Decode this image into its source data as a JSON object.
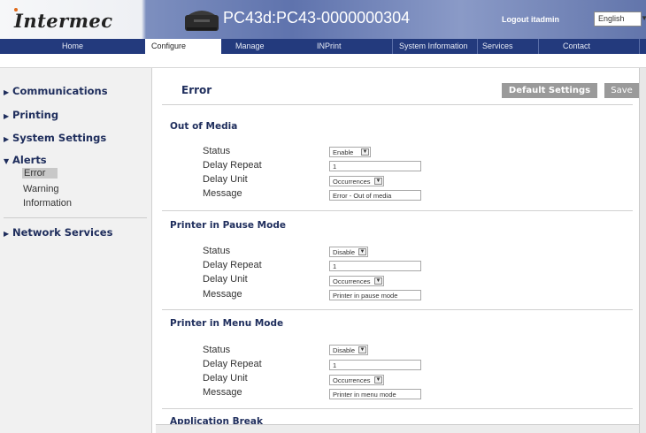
{
  "header": {
    "logo": "Intermec",
    "title": "PC43d:PC43-0000000304",
    "logout_label": "Logout itadmin",
    "language": "English"
  },
  "nav": {
    "items": [
      {
        "label": "Home"
      },
      {
        "label": "Configure"
      },
      {
        "label": "Manage"
      },
      {
        "label": "INPrint"
      },
      {
        "label": "System Information"
      },
      {
        "label": "Services"
      },
      {
        "label": "Contact"
      }
    ]
  },
  "sidebar": {
    "items": [
      {
        "label": "Communications"
      },
      {
        "label": "Printing"
      },
      {
        "label": "System Settings"
      },
      {
        "label": "Alerts"
      },
      {
        "label": "Network Services"
      }
    ],
    "alerts_sub": [
      {
        "label": "Error"
      },
      {
        "label": "Warning"
      },
      {
        "label": "Information"
      }
    ],
    "icons": {
      "collapsed": "right-triangle-icon",
      "expanded": "down-triangle-icon"
    }
  },
  "main": {
    "title": "Error",
    "default_settings_label": "Default Settings",
    "save_label": "Save",
    "field_labels": {
      "status": "Status",
      "delay_repeat": "Delay Repeat",
      "delay_unit": "Delay Unit",
      "message": "Message"
    },
    "sections": [
      {
        "title": "Out of Media",
        "status": "Enable",
        "delay_repeat": "1",
        "delay_unit": "Occurrences",
        "message": "Error - Out of media"
      },
      {
        "title": "Printer in Pause Mode",
        "status": "Disable",
        "delay_repeat": "1",
        "delay_unit": "Occurrences",
        "message": "Printer in pause mode"
      },
      {
        "title": "Printer in Menu Mode",
        "status": "Disable",
        "delay_repeat": "1",
        "delay_unit": "Occurrences",
        "message": "Printer in menu mode"
      },
      {
        "title": "Application Break"
      }
    ]
  },
  "colors": {
    "nav_bg": "#233a7d",
    "heading": "#1e2d5c",
    "button_disabled": "#9a9a9a"
  }
}
